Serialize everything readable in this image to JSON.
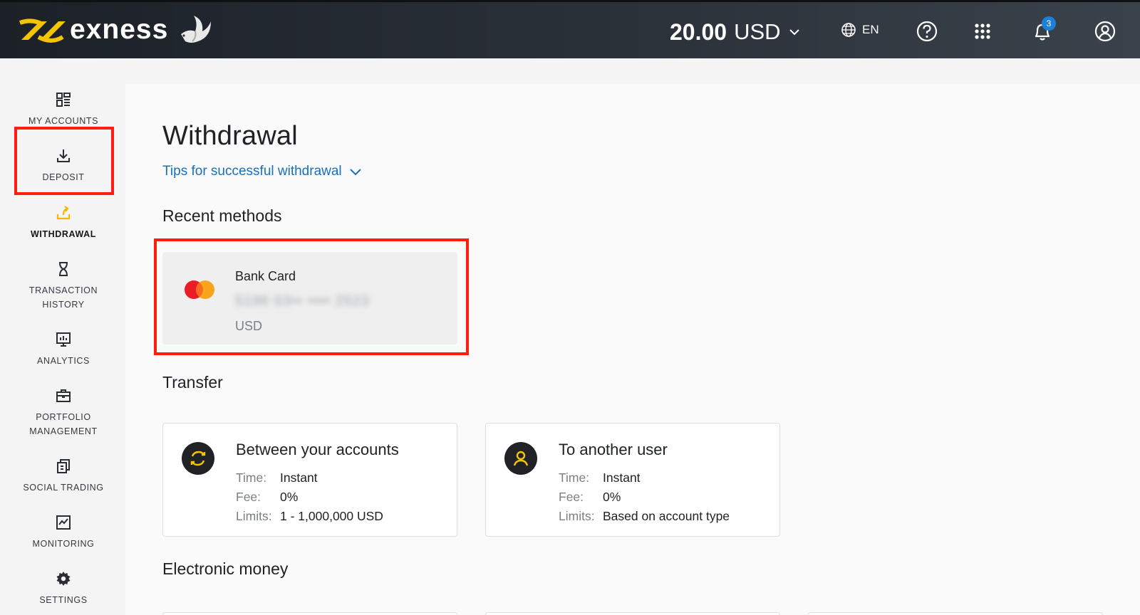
{
  "header": {
    "logo_text": "exness",
    "balance_amount": "20.00",
    "balance_currency": "USD",
    "language": "EN",
    "notifications_count": "3",
    "accent_color": "#f5c400"
  },
  "sidebar": {
    "items": [
      {
        "label": "MY ACCOUNTS",
        "icon": "dashboard-icon"
      },
      {
        "label": "DEPOSIT",
        "icon": "download-icon"
      },
      {
        "label": "WITHDRAWAL",
        "icon": "upload-icon",
        "active": true
      },
      {
        "label": "TRANSACTION HISTORY",
        "icon": "hourglass-icon"
      },
      {
        "label": "ANALYTICS",
        "icon": "presentation-icon"
      },
      {
        "label": "PORTFOLIO MANAGEMENT",
        "icon": "briefcase-icon"
      },
      {
        "label": "SOCIAL TRADING",
        "icon": "copy-icon"
      },
      {
        "label": "MONITORING",
        "icon": "chart-icon"
      },
      {
        "label": "SETTINGS",
        "icon": "gear-icon"
      }
    ]
  },
  "main": {
    "title": "Withdrawal",
    "tips_link": "Tips for successful withdrawal",
    "recent_methods_title": "Recent methods",
    "recent_method": {
      "name": "Bank Card",
      "number": "5196 03•• •••• 2523",
      "currency": "USD"
    },
    "transfer_title": "Transfer",
    "transfers": [
      {
        "title": "Between your accounts",
        "time_label": "Time:",
        "time": "Instant",
        "fee_label": "Fee:",
        "fee": "0%",
        "limits_label": "Limits:",
        "limits": "1 - 1,000,000 USD"
      },
      {
        "title": "To another user",
        "time_label": "Time:",
        "time": "Instant",
        "fee_label": "Fee:",
        "fee": "0%",
        "limits_label": "Limits:",
        "limits": "Based on account type"
      }
    ],
    "electronic_money_title": "Electronic money"
  }
}
